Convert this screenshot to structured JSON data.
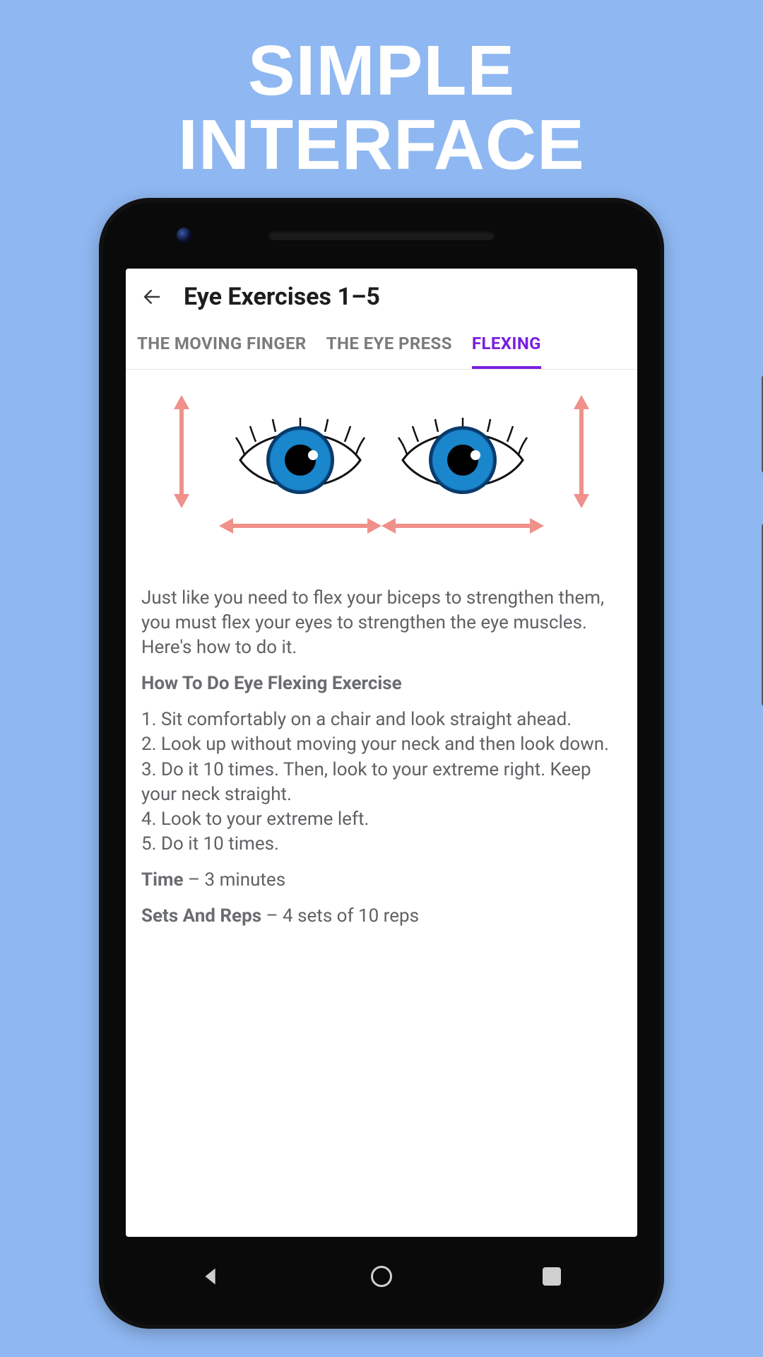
{
  "promo": {
    "line1": "SIMPLE",
    "line2": "INTERFACE"
  },
  "app": {
    "title": "Eye Exercises 1–5",
    "tabs": [
      {
        "label": "THE MOVING FINGER",
        "active": false
      },
      {
        "label": "THE EYE PRESS",
        "active": false
      },
      {
        "label": "FLEXING",
        "active": true
      }
    ],
    "content": {
      "intro": "Just like you need to flex your biceps to strengthen them, you must flex your eyes to strengthen the eye muscles. Here's how to do it.",
      "how_to_heading": "How To Do Eye Flexing Exercise",
      "steps": [
        "1. Sit comfortably on a chair and look straight ahead.",
        "2. Look up without moving your neck and then look down.",
        "3. Do it 10 times. Then, look to your extreme right. Keep your neck straight.",
        "4. Look to your extreme left.",
        "5. Do it 10 times."
      ],
      "time_label": "Time",
      "time_value": " – 3 minutes",
      "sets_label": "Sets And Reps",
      "sets_value": " – 4 sets of 10 reps"
    }
  },
  "nav": {
    "back": "back",
    "home": "home",
    "recents": "recents"
  }
}
